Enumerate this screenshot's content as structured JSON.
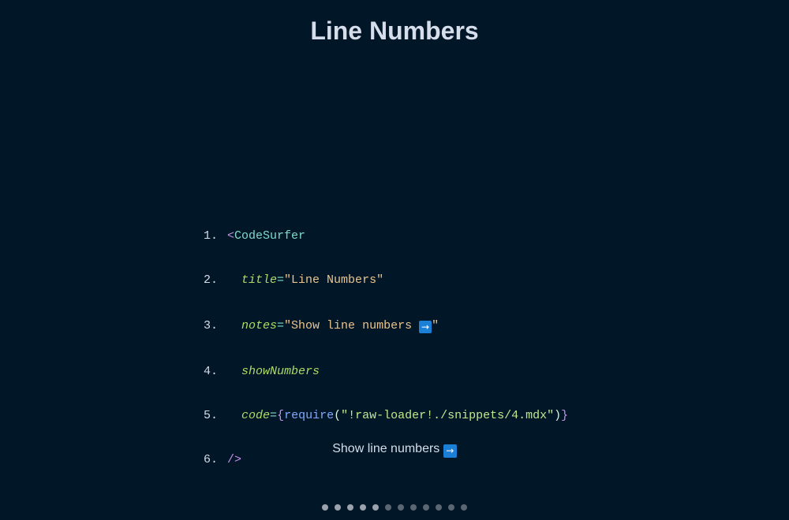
{
  "slide": {
    "title": "Line Numbers",
    "notes_text": "Show line numbers",
    "notes_icon": "right-arrow-emoji-icon"
  },
  "code": {
    "lines": [
      {
        "number": "1.",
        "tag_open": "<",
        "tag_name": "CodeSurfer"
      },
      {
        "number": "2.",
        "attr": "title",
        "eq": "=",
        "value": "\"Line Numbers\""
      },
      {
        "number": "3.",
        "attr": "notes",
        "eq": "=",
        "value_start": "\"Show line numbers ",
        "value_end": "\""
      },
      {
        "number": "4.",
        "attr": "showNumbers"
      },
      {
        "number": "5.",
        "attr": "code",
        "eq": "=",
        "brace_open": "{",
        "fn": "require",
        "paren_open": "(",
        "arg": "\"!raw-loader!./snippets/4.mdx\"",
        "paren_close": ")",
        "brace_close": "}"
      },
      {
        "number": "6.",
        "tag_close": "/>"
      }
    ],
    "arrow_glyph": "→"
  },
  "progress": {
    "total_slides": 12,
    "visited": 5
  },
  "colors": {
    "background": "#011627",
    "text": "#d6deeb",
    "arrow_box": "#1b7fd6",
    "dot_inactive": "#5a6673",
    "dot_visited": "#9aa3ad"
  }
}
